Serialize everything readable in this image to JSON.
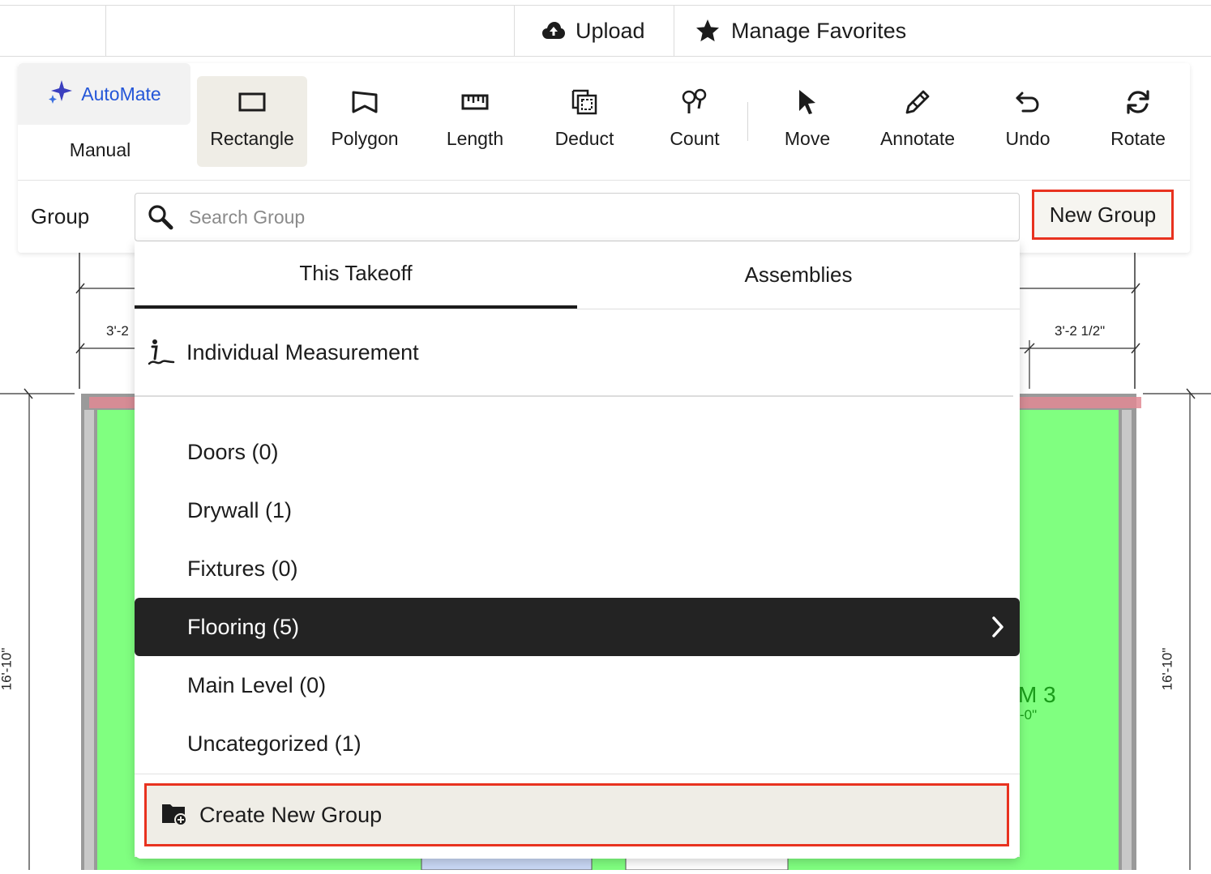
{
  "topbar": {
    "upload_label": "Upload",
    "favorites_label": "Manage Favorites",
    "icons": [
      "cloud-upload-icon",
      "star-icon"
    ]
  },
  "toolbar": {
    "automate_label": "AutoMate",
    "manual_label": "Manual",
    "tools": [
      {
        "label": "Rectangle",
        "icon": "rectangle-icon",
        "active": true
      },
      {
        "label": "Polygon",
        "icon": "polygon-icon"
      },
      {
        "label": "Length",
        "icon": "ruler-icon"
      },
      {
        "label": "Deduct",
        "icon": "deduct-icon"
      },
      {
        "label": "Count",
        "icon": "count-pins-icon"
      },
      {
        "label": "Move",
        "icon": "cursor-arrow-icon"
      },
      {
        "label": "Annotate",
        "icon": "pen-icon"
      },
      {
        "label": "Undo",
        "icon": "undo-icon"
      },
      {
        "label": "Rotate",
        "icon": "rotate-icon"
      }
    ],
    "accent_color": "#2456d8"
  },
  "group_bar": {
    "label": "Group",
    "search_placeholder": "Search Group",
    "search_value": "",
    "new_group_label": "New Group",
    "highlight_color": "#e8321f"
  },
  "dropdown": {
    "tabs": [
      {
        "label": "This Takeoff",
        "active": true
      },
      {
        "label": "Assemblies",
        "active": false
      }
    ],
    "individual_label": "Individual Measurement",
    "groups": [
      {
        "label": "Doors (0)"
      },
      {
        "label": "Drywall (1)"
      },
      {
        "label": "Fixtures (0)"
      },
      {
        "label": "Flooring (5)",
        "selected": true
      },
      {
        "label": "Main Level (0)"
      },
      {
        "label": "Uncategorized (1)"
      }
    ],
    "create_label": "Create New Group"
  },
  "plan": {
    "dim_left_top": "3'-2",
    "dim_right_top": "3'-2 1/2\"",
    "dim_left_side": "16'-10\"",
    "dim_right_side": "16'-10\"",
    "room_label": "M 3",
    "room_sub": "-0\"",
    "room_fill": "#80ff80"
  }
}
